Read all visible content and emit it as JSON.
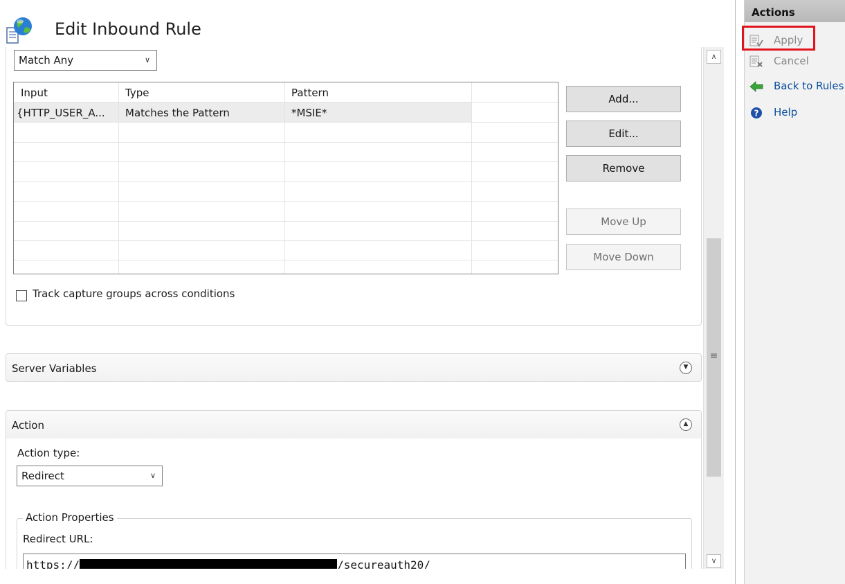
{
  "header": {
    "title": "Edit Inbound Rule"
  },
  "conditions": {
    "match_select": "Match Any",
    "columns": [
      "Input",
      "Type",
      "Pattern"
    ],
    "rows": [
      {
        "input": "{HTTP_USER_A...",
        "type": "Matches the Pattern",
        "pattern": "*MSIE*"
      }
    ],
    "buttons": {
      "add": "Add...",
      "edit": "Edit...",
      "remove": "Remove",
      "move_up": "Move Up",
      "move_down": "Move Down"
    },
    "track_label": "Track capture groups across conditions"
  },
  "server_variables": {
    "title": "Server Variables"
  },
  "action": {
    "title": "Action",
    "type_label": "Action type:",
    "type_value": "Redirect",
    "properties_legend": "Action Properties",
    "redirect_label": "Redirect URL:",
    "redirect_prefix": "https://",
    "redirect_suffix": "/secureauth20/"
  },
  "actions_pane": {
    "title": "Actions",
    "items": [
      {
        "label": "Apply",
        "icon": "apply-icon",
        "enabled": false
      },
      {
        "label": "Cancel",
        "icon": "cancel-icon",
        "enabled": false
      },
      {
        "label": "Back to Rules",
        "icon": "back-arrow-icon",
        "enabled": true
      },
      {
        "label": "Help",
        "icon": "help-icon",
        "enabled": true
      }
    ]
  },
  "colors": {
    "highlight": "#e0141e",
    "link": "#0b4f9e",
    "back_arrow": "#3aa33a",
    "help": "#1f4fa8"
  }
}
